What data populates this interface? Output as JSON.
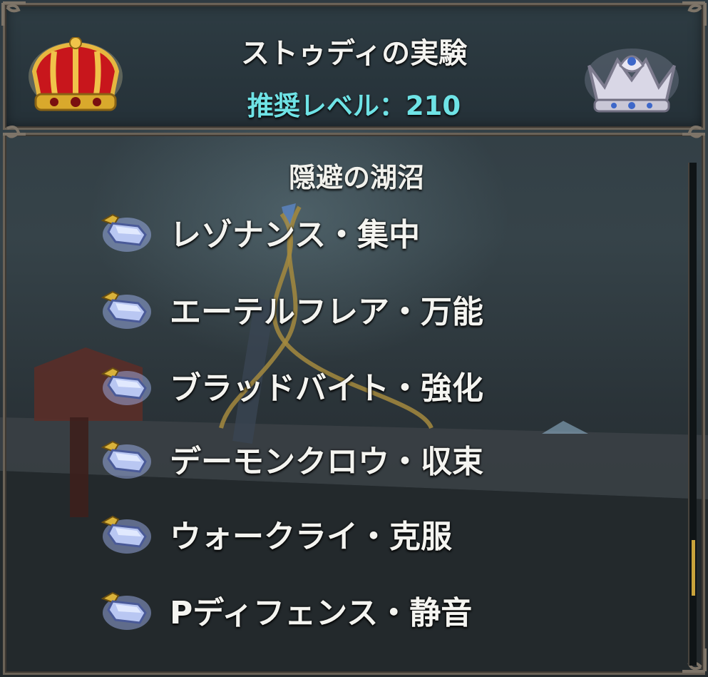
{
  "header": {
    "title": "ストゥディの実験",
    "recommended_level": "推奨レベル：210"
  },
  "section": {
    "title": "隠避の湖沼"
  },
  "items": [
    {
      "label": "レゾナンス・集中",
      "icon": "gem-icon"
    },
    {
      "label": "エーテルフレア・万能",
      "icon": "gem-icon"
    },
    {
      "label": "ブラッドバイト・強化",
      "icon": "gem-icon"
    },
    {
      "label": "デーモンクロウ・収束",
      "icon": "gem-icon"
    },
    {
      "label": "ウォークライ・克服",
      "icon": "gem-icon"
    },
    {
      "label": "Pディフェンス・静音",
      "icon": "gem-icon"
    }
  ],
  "icons": {
    "left": "gold-crown-icon",
    "right": "silver-crown-icon"
  },
  "colors": {
    "level_text": "#6fe3e6",
    "gold": "#d9a92c",
    "ruby": "#c8161c",
    "silver": "#c9c7d6",
    "scroll_thumb": "#c9a33b"
  },
  "scroll": {
    "position_fraction": 0.75
  }
}
